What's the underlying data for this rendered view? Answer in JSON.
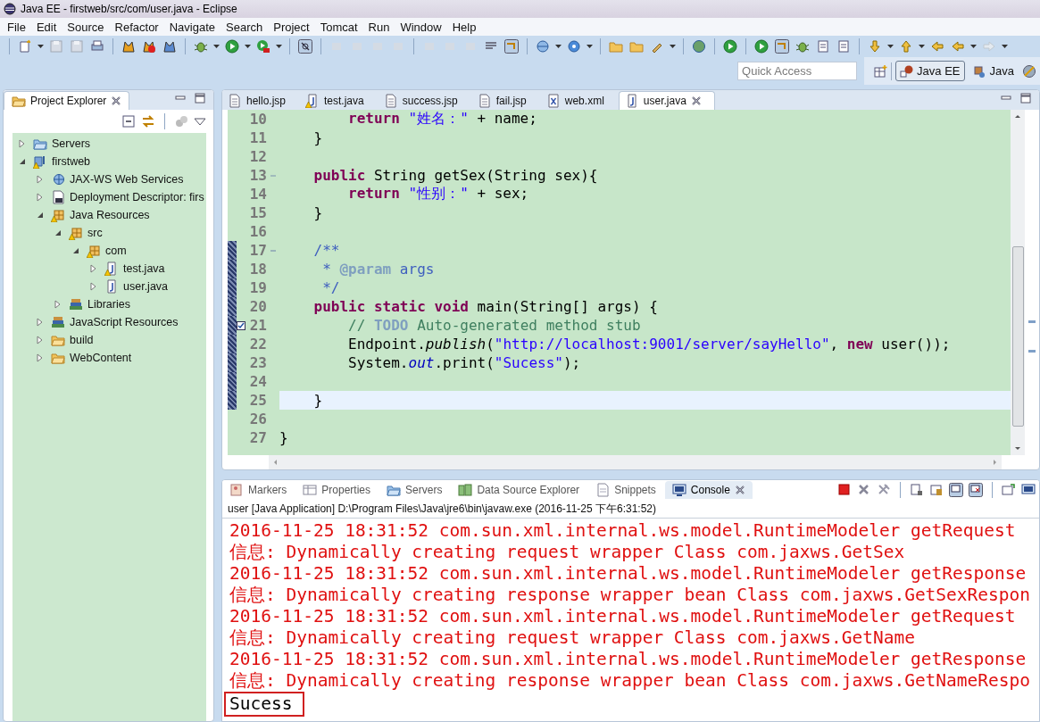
{
  "window": {
    "title": "Java EE - firstweb/src/com/user.java - Eclipse"
  },
  "menu": [
    "File",
    "Edit",
    "Source",
    "Refactor",
    "Navigate",
    "Search",
    "Project",
    "Tomcat",
    "Run",
    "Window",
    "Help"
  ],
  "quick_access": {
    "placeholder": "Quick Access"
  },
  "perspectives": [
    {
      "label": "Java EE",
      "selected": true
    },
    {
      "label": "Java",
      "selected": false
    }
  ],
  "project_explorer": {
    "title": "Project Explorer",
    "tree": [
      {
        "label": "Servers",
        "kind": "servers",
        "warning": false,
        "expanded": false
      },
      {
        "label": "firstweb",
        "kind": "project",
        "warning": true,
        "expanded": true,
        "children": [
          {
            "label": "JAX-WS Web Services",
            "kind": "webservices",
            "warning": false,
            "expanded": false
          },
          {
            "label": "Deployment Descriptor: firs",
            "kind": "descriptor",
            "warning": false,
            "expanded": false
          },
          {
            "label": "Java Resources",
            "kind": "resources",
            "warning": true,
            "expanded": true,
            "children": [
              {
                "label": "src",
                "kind": "resources",
                "warning": true,
                "expanded": true,
                "children": [
                  {
                    "label": "com",
                    "kind": "package",
                    "warning": true,
                    "expanded": true,
                    "children": [
                      {
                        "label": "test.java",
                        "kind": "java",
                        "warning": true,
                        "expanded": false
                      },
                      {
                        "label": "user.java",
                        "kind": "java",
                        "warning": false,
                        "expanded": false
                      }
                    ]
                  }
                ]
              },
              {
                "label": "Libraries",
                "kind": "library",
                "warning": false,
                "expanded": false
              }
            ]
          },
          {
            "label": "JavaScript Resources",
            "kind": "library",
            "warning": false,
            "expanded": false
          },
          {
            "label": "build",
            "kind": "folder",
            "warning": false,
            "expanded": false
          },
          {
            "label": "WebContent",
            "kind": "folder",
            "warning": false,
            "expanded": false
          }
        ]
      }
    ]
  },
  "editor": {
    "tabs": [
      {
        "label": "hello.jsp",
        "kind": "page",
        "warning": false,
        "selected": false
      },
      {
        "label": "test.java",
        "kind": "java",
        "warning": true,
        "selected": false
      },
      {
        "label": "success.jsp",
        "kind": "page",
        "warning": false,
        "selected": false
      },
      {
        "label": "fail.jsp",
        "kind": "page",
        "warning": false,
        "selected": false
      },
      {
        "label": "web.xml",
        "kind": "xml",
        "warning": false,
        "selected": false
      },
      {
        "label": "user.java",
        "kind": "java",
        "warning": false,
        "selected": true
      }
    ],
    "lines": [
      {
        "number": "10",
        "changed": false,
        "current": false,
        "fold": false,
        "task": false,
        "segments": [
          {
            "kind": "kw",
            "text": "        return "
          },
          {
            "kind": "str",
            "text": "\"姓名：\""
          },
          {
            "kind": "plain",
            "text": " + name;"
          }
        ]
      },
      {
        "number": "11",
        "changed": false,
        "current": false,
        "fold": false,
        "task": false,
        "segments": [
          {
            "kind": "plain",
            "text": "    }"
          }
        ]
      },
      {
        "number": "12",
        "changed": false,
        "current": false,
        "fold": false,
        "task": false
      },
      {
        "number": "13",
        "changed": false,
        "current": false,
        "fold": true,
        "task": false,
        "segments": [
          {
            "kind": "kw",
            "text": "    public"
          },
          {
            "kind": "plain",
            "text": " String getSex(String sex){"
          }
        ]
      },
      {
        "number": "14",
        "changed": false,
        "current": false,
        "fold": false,
        "task": false,
        "segments": [
          {
            "kind": "kw",
            "text": "        return "
          },
          {
            "kind": "str",
            "text": "\"性别：\""
          },
          {
            "kind": "plain",
            "text": " + sex;"
          }
        ]
      },
      {
        "number": "15",
        "changed": false,
        "current": false,
        "fold": false,
        "task": false,
        "segments": [
          {
            "kind": "plain",
            "text": "    }"
          }
        ]
      },
      {
        "number": "16",
        "changed": false,
        "current": false,
        "fold": false,
        "task": false
      },
      {
        "number": "17",
        "changed": true,
        "current": false,
        "fold": true,
        "task": false,
        "segments": [
          {
            "kind": "doc",
            "text": "    /**"
          }
        ]
      },
      {
        "number": "18",
        "changed": true,
        "current": false,
        "fold": false,
        "task": false,
        "segments": [
          {
            "kind": "doc",
            "text": "     * "
          },
          {
            "kind": "doctag",
            "text": "@param"
          },
          {
            "kind": "doc",
            "text": " args"
          }
        ]
      },
      {
        "number": "19",
        "changed": true,
        "current": false,
        "fold": false,
        "task": false,
        "segments": [
          {
            "kind": "doc",
            "text": "     */"
          }
        ]
      },
      {
        "number": "20",
        "changed": true,
        "current": false,
        "fold": false,
        "task": false,
        "segments": [
          {
            "kind": "kw",
            "text": "    public static void"
          },
          {
            "kind": "plain",
            "text": " main(String[] args) {"
          }
        ]
      },
      {
        "number": "21",
        "changed": true,
        "current": false,
        "fold": false,
        "task": true,
        "segments": [
          {
            "kind": "comment",
            "text": "        // "
          },
          {
            "kind": "todo",
            "text": "TODO"
          },
          {
            "kind": "comment",
            "text": " Auto-generated method stub"
          }
        ]
      },
      {
        "number": "22",
        "changed": true,
        "current": false,
        "fold": false,
        "task": false,
        "segments": [
          {
            "kind": "plain",
            "text": "        Endpoint."
          },
          {
            "kind": "static_method",
            "text": "publish"
          },
          {
            "kind": "plain",
            "text": "("
          },
          {
            "kind": "str",
            "text": "\"http://localhost:9001/server/sayHello\""
          },
          {
            "kind": "plain",
            "text": ", "
          },
          {
            "kind": "kw",
            "text": "new"
          },
          {
            "kind": "plain",
            "text": " user());"
          }
        ]
      },
      {
        "number": "23",
        "changed": true,
        "current": false,
        "fold": false,
        "task": false,
        "segments": [
          {
            "kind": "plain",
            "text": "        System."
          },
          {
            "kind": "static_field",
            "text": "out"
          },
          {
            "kind": "plain",
            "text": ".print("
          },
          {
            "kind": "str",
            "text": "\"Sucess\""
          },
          {
            "kind": "plain",
            "text": ");"
          }
        ]
      },
      {
        "number": "24",
        "changed": true,
        "current": false,
        "fold": false,
        "task": false
      },
      {
        "number": "25",
        "changed": true,
        "current": true,
        "fold": false,
        "task": false,
        "segments": [
          {
            "kind": "plain",
            "text": "    }"
          }
        ]
      },
      {
        "number": "26",
        "changed": false,
        "current": false,
        "fold": false,
        "task": false
      },
      {
        "number": "27",
        "changed": false,
        "current": false,
        "fold": false,
        "task": false,
        "segments": [
          {
            "kind": "plain",
            "text": "}"
          }
        ]
      }
    ]
  },
  "console": {
    "tabs": [
      {
        "label": "Markers",
        "kind": "markers",
        "selected": false
      },
      {
        "label": "Properties",
        "kind": "properties",
        "selected": false
      },
      {
        "label": "Servers",
        "kind": "servers",
        "selected": false
      },
      {
        "label": "Data Source Explorer",
        "kind": "datasource",
        "selected": false
      },
      {
        "label": "Snippets",
        "kind": "snippets",
        "selected": false
      },
      {
        "label": "Console",
        "kind": "console",
        "selected": true
      }
    ],
    "description": "user [Java Application] D:\\Program Files\\Java\\jre6\\bin\\javaw.exe (2016-11-25 下午6:31:52)",
    "lines": [
      {
        "kind": "log",
        "boxed": false,
        "text": "2016-11-25 18:31:52 com.sun.xml.internal.ws.model.RuntimeModeler getRequest"
      },
      {
        "kind": "log",
        "boxed": false,
        "text": "信息: Dynamically creating request wrapper Class com.jaxws.GetSex"
      },
      {
        "kind": "log",
        "boxed": false,
        "text": "2016-11-25 18:31:52 com.sun.xml.internal.ws.model.RuntimeModeler getResponse"
      },
      {
        "kind": "log",
        "boxed": false,
        "text": "信息: Dynamically creating response wrapper bean Class com.jaxws.GetSexRespon"
      },
      {
        "kind": "log",
        "boxed": false,
        "text": "2016-11-25 18:31:52 com.sun.xml.internal.ws.model.RuntimeModeler getRequest"
      },
      {
        "kind": "log",
        "boxed": false,
        "text": "信息: Dynamically creating request wrapper Class com.jaxws.GetName"
      },
      {
        "kind": "log",
        "boxed": false,
        "text": "2016-11-25 18:31:52 com.sun.xml.internal.ws.model.RuntimeModeler getResponse"
      },
      {
        "kind": "log",
        "boxed": false,
        "text": "信息: Dynamically creating response wrapper bean Class com.jaxws.GetNameRespo"
      },
      {
        "kind": "output",
        "boxed": true,
        "text": "Sucess"
      }
    ]
  }
}
